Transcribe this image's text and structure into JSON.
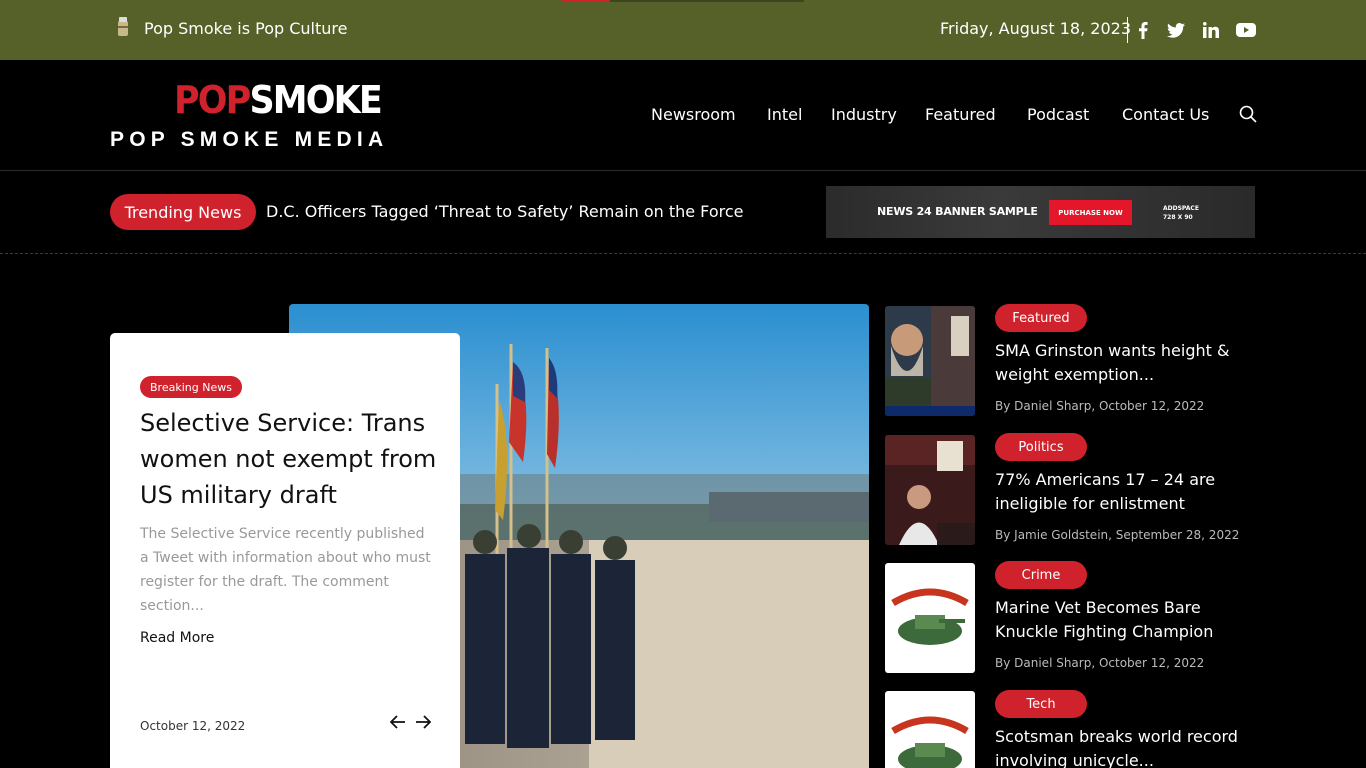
{
  "topbar": {
    "tagline": "Pop Smoke is Pop Culture",
    "date": "Friday, August 18, 2023",
    "reading_progress": 0.2,
    "social": [
      "facebook-icon",
      "twitter-icon",
      "linkedin-icon",
      "youtube-icon"
    ]
  },
  "header": {
    "logo_pop": "POP",
    "logo_smoke": "SMOKE",
    "logo_sub": "POP SMOKE MEDIA",
    "nav": [
      "Newsroom",
      "Intel",
      "Industry",
      "Featured",
      "Podcast",
      "Contact Us"
    ]
  },
  "trending": {
    "label": "Trending News",
    "headline": "D.C. Officers Tagged ‘Threat to Safety’ Remain on the Force"
  },
  "banner": {
    "title": "NEWS 24 BANNER SAMPLE",
    "button": "PURCHASE NOW",
    "ad_line1": "ADDSPACE",
    "ad_line2": "728 X 90"
  },
  "hero": {
    "badge": "Breaking News",
    "title": "Selective Service: Trans women not exempt from US military draft",
    "excerpt": "The Selective Service recently published a Tweet with information about who must register for the draft. The comment section...",
    "read_more": "Read More",
    "date": "October 12, 2022"
  },
  "side": [
    {
      "category": "Featured",
      "title": "SMA Grinston wants height & weight exemption...",
      "meta": "By Daniel Sharp, October 12, 2022"
    },
    {
      "category": "Politics",
      "title": "77% Americans 17 – 24 are ineligible for enlistment",
      "meta": "By Jamie Goldstein, September 28, 2022"
    },
    {
      "category": "Crime",
      "title": "Marine Vet Becomes Bare Knuckle Fighting Champion",
      "meta": "By Daniel Sharp, October 12, 2022"
    },
    {
      "category": "Tech",
      "title": "Scotsman breaks world record involving unicycle...",
      "meta": ""
    }
  ],
  "colors": {
    "topbar": "#56612a",
    "accent": "#d0222c",
    "background": "#000000"
  }
}
